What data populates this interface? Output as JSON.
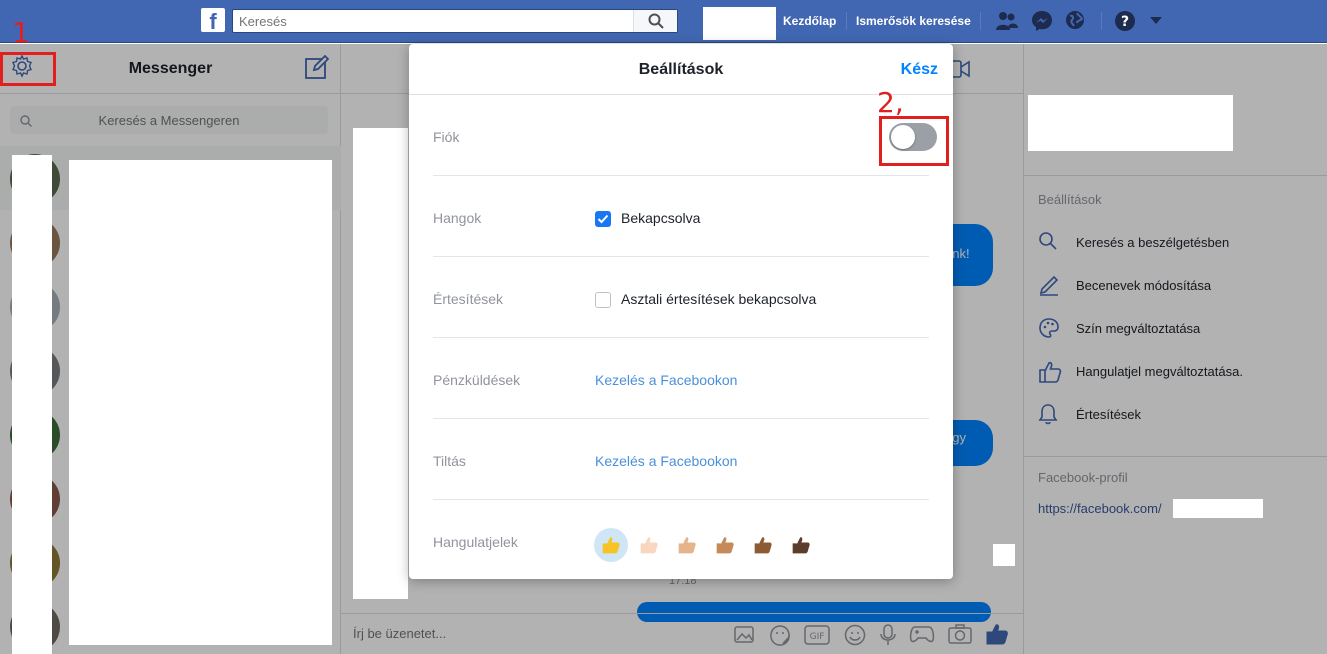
{
  "topbar": {
    "logo": "f",
    "search_placeholder": "Keresés",
    "nav_home": "Kezdőlap",
    "nav_find_friends": "Ismerősök keresése"
  },
  "left": {
    "title": "Messenger",
    "search_placeholder": "Keresés a Messengeren",
    "annotation_1": "1"
  },
  "chat": {
    "bubble1": "unk!",
    "bubble2": "ogy",
    "timestamp": "17:18",
    "composer_placeholder": "Írj be üzenetet..."
  },
  "right": {
    "settings_heading": "Beállítások",
    "items": [
      {
        "label": "Keresés a beszélgetésben",
        "icon": "search-icon"
      },
      {
        "label": "Becenevek módosítása",
        "icon": "pencil-icon"
      },
      {
        "label": "Szín megváltoztatása",
        "icon": "palette-icon"
      },
      {
        "label": "Hangulatjel megváltoztatása.",
        "icon": "thumbs-up-icon"
      },
      {
        "label": "Értesítések",
        "icon": "bell-icon"
      }
    ],
    "profile_heading": "Facebook-profil",
    "profile_link": "https://facebook.com/"
  },
  "modal": {
    "title": "Beállítások",
    "done": "Kész",
    "annotation_2": "2,",
    "account_label": "Fiók",
    "sounds_label": "Hangok",
    "sounds_value": "Bekapcsolva",
    "notifications_label": "Értesítések",
    "notifications_value": "Asztali értesítések bekapcsolva",
    "payments_label": "Pénzküldések",
    "payments_link": "Kezelés a Facebookon",
    "block_label": "Tiltás",
    "block_link": "Kezelés a Facebookon",
    "emoji_label": "Hangulatjelek",
    "skin_tones": [
      "#f7c325",
      "#f8d6c0",
      "#e6b48a",
      "#c58a58",
      "#8d5a34",
      "#5c3c2a"
    ]
  }
}
